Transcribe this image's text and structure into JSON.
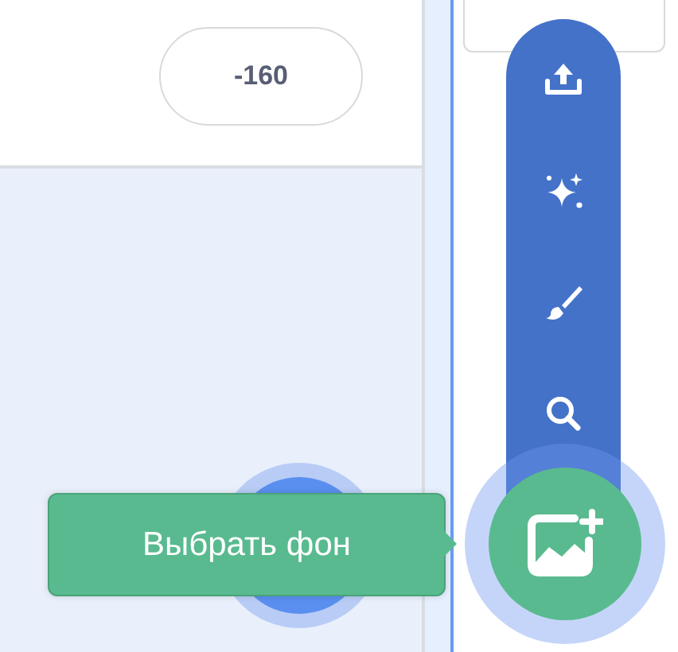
{
  "coordinate_field": {
    "value": "-160"
  },
  "backdrop_menu": {
    "expanded": true,
    "items": [
      {
        "kind": "upload"
      },
      {
        "kind": "surprise"
      },
      {
        "kind": "paint"
      },
      {
        "kind": "search"
      }
    ]
  },
  "tooltip": {
    "text": "Выбрать фон"
  }
}
